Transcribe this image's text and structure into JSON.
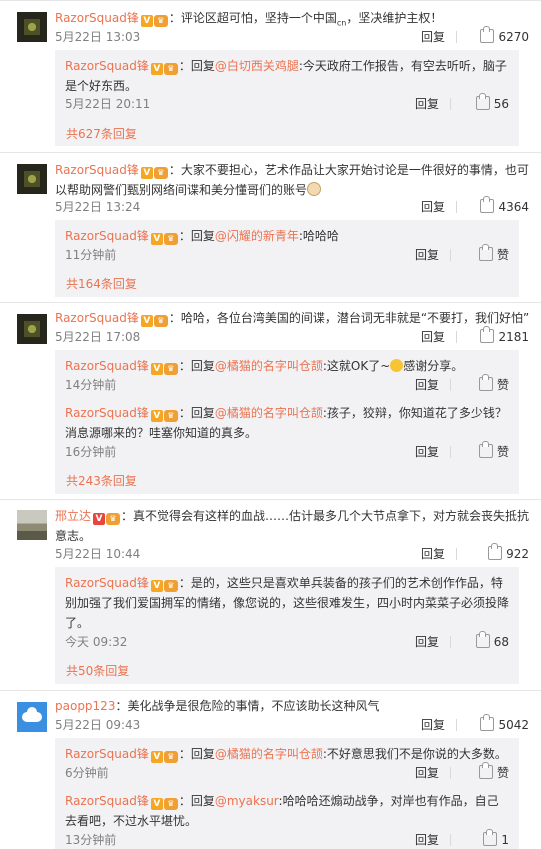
{
  "comments": [
    {
      "user": "RazorSquad锋",
      "text": "：评论区超可怕，坚持一个中国",
      "text_cn": "cn",
      "text2": "，坚决维护主权！",
      "time": "5月22日 13:03",
      "reply": "回复",
      "likes": "6270",
      "replies": [
        {
          "user": "RazorSquad锋",
          "prefix": "：回复",
          "at": "@白切西关鸡腿",
          "text": ":今天政府工作报告，有空去听听，脑子是个好东西。",
          "time": "5月22日 20:11",
          "reply": "回复",
          "likes": "56"
        }
      ],
      "more": "共627条回复"
    },
    {
      "user": "RazorSquad锋",
      "text": "：大家不要担心，艺术作品让大家开始讨论是一件很好的事情，也可以帮助网警们甄别网络间谍和美分懂哥们的账号",
      "time": "5月22日 13:24",
      "reply": "回复",
      "likes": "4364",
      "replies": [
        {
          "user": "RazorSquad锋",
          "prefix": "：回复",
          "at": "@闪耀的新青年",
          "text": ":哈哈哈",
          "time": "11分钟前",
          "reply": "回复",
          "likes": "赞"
        }
      ],
      "more": "共164条回复"
    },
    {
      "user": "RazorSquad锋",
      "text": "：哈哈，各位台湾美国的间谍，潜台词无非就是“不要打，我们好怕”",
      "time": "5月22日 17:08",
      "reply": "回复",
      "likes": "2181",
      "replies": [
        {
          "user": "RazorSquad锋",
          "prefix": "：回复",
          "at": "@橘猫的名字叫仓颉",
          "text": ":这就OK了~",
          "text2": "感谢分享。",
          "time": "14分钟前",
          "reply": "回复",
          "likes": "赞"
        },
        {
          "user": "RazorSquad锋",
          "prefix": "：回复",
          "at": "@橘猫的名字叫仓颉",
          "text": ":孩子，狡辩，你知道花了多少钱？消息源哪来的？哇塞你知道的真多。",
          "time": "16分钟前",
          "reply": "回复",
          "likes": "赞"
        }
      ],
      "more": "共243条回复"
    },
    {
      "user": "邢立达",
      "text": "：真不觉得会有这样的血战……估计最多几个大节点拿下，对方就会丧失抵抗意志。",
      "time": "5月22日 10:44",
      "reply": "回复",
      "likes": "922",
      "replies": [
        {
          "user": "RazorSquad锋",
          "prefix": "：",
          "at": "",
          "text": "是的，这些只是喜欢单兵装备的孩子们的艺术创作作品，特别加强了我们爱国拥军的情绪，像您说的，这些很难发生，四小时内菜菜子必须投降了。",
          "time": "今天 09:32",
          "reply": "回复",
          "likes": "68"
        }
      ],
      "more": "共50条回复"
    },
    {
      "user": "paopp123",
      "text": "：美化战争是很危险的事情，不应该助长这种风气",
      "time": "5月22日 09:43",
      "reply": "回复",
      "likes": "5042",
      "replies": [
        {
          "user": "RazorSquad锋",
          "prefix": "：回复",
          "at": "@橘猫的名字叫仓颉",
          "text": ":不好意思我们不是你说的大多数。",
          "time": "6分钟前",
          "reply": "回复",
          "likes": "赞"
        },
        {
          "user": "RazorSquad锋",
          "prefix": "：回复",
          "at": "@myaksur",
          "text": ":哈哈哈还煽动战争，对岸也有作品，自己去看吧，不过水平堪忧。",
          "time": "13分钟前",
          "reply": "回复",
          "likes": "1"
        }
      ]
    }
  ],
  "badges": {
    "verified": "V"
  },
  "colors": {
    "link": "#eb7350",
    "reply_bg": "#f2f2f5"
  }
}
